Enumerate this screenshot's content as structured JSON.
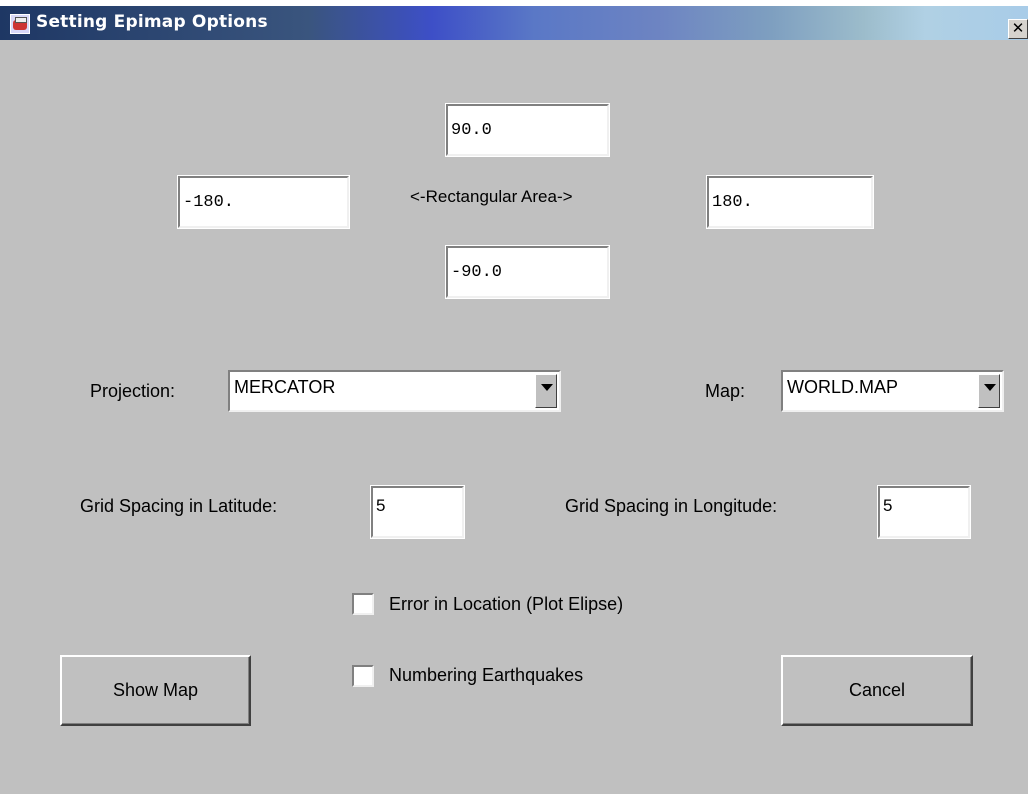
{
  "window": {
    "title": "Setting Epimap Options",
    "close_label": "✕"
  },
  "area": {
    "north": "90.0",
    "west": "-180.",
    "east": "180.",
    "south": "-90.0",
    "label": "<-Rectangular Area->"
  },
  "projection": {
    "label": "Projection:",
    "value": "MERCATOR"
  },
  "map": {
    "label": "Map:",
    "value": "WORLD.MAP"
  },
  "grid": {
    "lat_label": "Grid Spacing in Latitude:",
    "lat_value": "5",
    "lon_label": "Grid Spacing in Longitude:",
    "lon_value": "5"
  },
  "options": {
    "error_location": {
      "label": "Error in Location (Plot Elipse)",
      "checked": false
    },
    "numbering": {
      "label": "Numbering Earthquakes",
      "checked": false
    }
  },
  "buttons": {
    "show_map": "Show Map",
    "cancel": "Cancel"
  },
  "colors": {
    "background": "#c0c0c0",
    "title_start": "#1e3764",
    "title_end": "#a8cce8"
  }
}
